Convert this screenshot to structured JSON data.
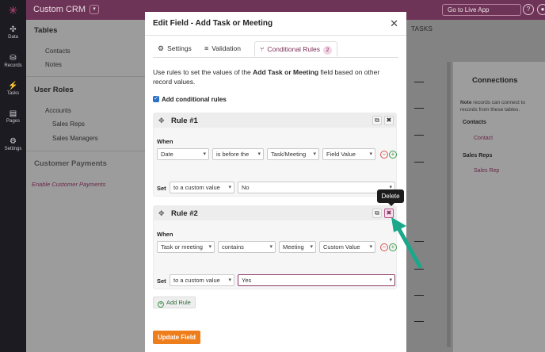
{
  "app": {
    "title": "Custom CRM",
    "caret": "▾",
    "live_label": "Go to Live App",
    "help_icon": "?",
    "user_icon": "●",
    "logo_icon": "✳"
  },
  "rail": [
    {
      "icon": "✣",
      "label": "Data"
    },
    {
      "icon": "⛁",
      "label": "Records"
    },
    {
      "icon": "⚡",
      "label": "Tasks"
    },
    {
      "icon": "▤",
      "label": "Pages"
    },
    {
      "icon": "⚙",
      "label": "Settings"
    }
  ],
  "left_panel": {
    "tables_heading": "Tables",
    "tables": [
      "Contacts",
      "Notes"
    ],
    "roles_heading": "User Roles",
    "accounts": "Accounts",
    "roles": [
      "Sales Reps",
      "Sales Managers"
    ],
    "payments_heading": "Customer Payments",
    "payments_link": "Enable Customer Payments"
  },
  "background": {
    "tasks_label": "TASKS",
    "dash": "—",
    "connections_title": "Connections",
    "connections_note_bold": "Note",
    "connections_note": "records can connect to records from these tables.",
    "connections": [
      {
        "group": "Contacts",
        "child": "Contact"
      },
      {
        "group": "Sales Reps",
        "child": "Sales Rep"
      }
    ]
  },
  "modal": {
    "title": "Edit Field - Add Task or Meeting",
    "close": "✕",
    "tabs": [
      {
        "icon": "⚙",
        "label": "Settings"
      },
      {
        "icon": "≡",
        "label": "Validation"
      },
      {
        "icon": "⑂",
        "label": "Conditional Rules",
        "badge": "2"
      }
    ],
    "intro_pre": "Use rules to set the values of the ",
    "intro_field": "Add Task or Meeting",
    "intro_post": " field based on other record values.",
    "checkbox_label": "Add conditional rules",
    "checkbox_mark": "✓",
    "rules": [
      {
        "title": "Rule #1",
        "when": "When",
        "conditions": [
          "Date",
          "is before the",
          "Task/Meeting",
          "Field Value"
        ],
        "set": "Set",
        "set_mode": "to a custom value",
        "set_value": "No"
      },
      {
        "title": "Rule #2",
        "when": "When",
        "conditions": [
          "Task or meeting",
          "contains",
          "Meeting",
          "Custom Value"
        ],
        "set": "Set",
        "set_mode": "to a custom value",
        "set_value": "Yes"
      }
    ],
    "copy_icon": "⧉",
    "delete_icon": "✖",
    "move_icon": "✥",
    "minus": "−",
    "plus": "+",
    "tooltip": "Delete",
    "add_rule": "Add Rule",
    "update_button": "Update Field"
  },
  "colors": {
    "brand": "#6e3457",
    "accent": "#7b2c57",
    "primary_button": "#ee7d1b",
    "arrow": "#1aa88a"
  }
}
